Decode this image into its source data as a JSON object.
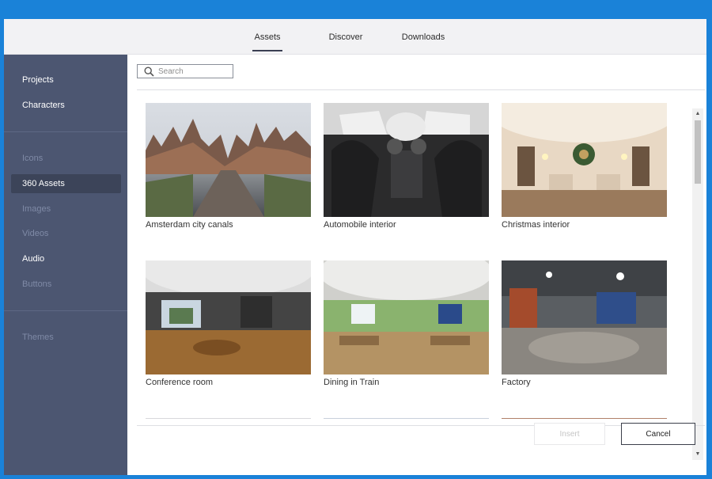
{
  "tabs": [
    {
      "label": "Assets",
      "active": true
    },
    {
      "label": "Discover",
      "active": false
    },
    {
      "label": "Downloads",
      "active": false
    }
  ],
  "sidebar": {
    "items": [
      {
        "label": "Projects",
        "state": "enabled"
      },
      {
        "label": "Characters",
        "state": "enabled"
      },
      {
        "label": "Icons",
        "state": "disabled"
      },
      {
        "label": "360 Assets",
        "state": "selected"
      },
      {
        "label": "Images",
        "state": "disabled"
      },
      {
        "label": "Videos",
        "state": "disabled"
      },
      {
        "label": "Audio",
        "state": "enabled"
      },
      {
        "label": "Buttons",
        "state": "disabled"
      },
      {
        "label": "Themes",
        "state": "disabled"
      }
    ]
  },
  "search": {
    "placeholder": "Search",
    "value": ""
  },
  "assets": [
    {
      "title": "Amsterdam city canals"
    },
    {
      "title": "Automobile interior"
    },
    {
      "title": "Christmas interior"
    },
    {
      "title": "Conference room"
    },
    {
      "title": "Dining in Train"
    },
    {
      "title": "Factory"
    }
  ],
  "footer": {
    "insert_label": "Insert",
    "cancel_label": "Cancel"
  },
  "colors": {
    "frame_blue": "#1a82d8",
    "sidebar_bg": "#4c5671",
    "sidebar_selected": "#3c4459",
    "sidebar_disabled_text": "#7f8aa6"
  },
  "icons": {
    "search": "magnifier-icon",
    "scroll_up": "triangle-up",
    "scroll_down": "triangle-down"
  }
}
